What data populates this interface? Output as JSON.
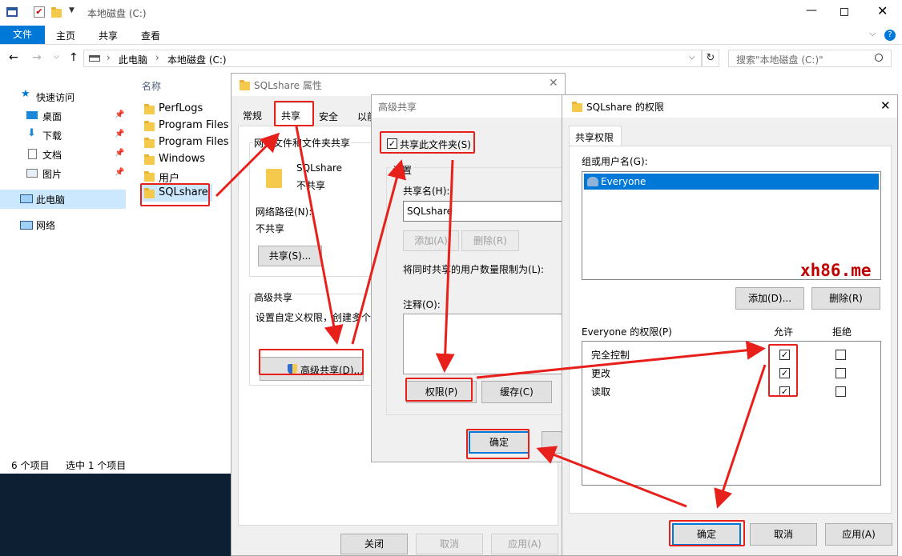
{
  "explorer": {
    "title": "本地磁盘 (C:)",
    "ribbon_tabs": [
      "文件",
      "主页",
      "共享",
      "查看"
    ],
    "breadcrumb": [
      "此电脑",
      "本地磁盘 (C:)"
    ],
    "search_placeholder": "搜索\"本地磁盘 (C:)\"",
    "column_name": "名称",
    "nav": {
      "quick_access": "快速访问",
      "items": [
        "桌面",
        "下载",
        "文档",
        "图片"
      ],
      "this_pc": "此电脑",
      "network": "网络"
    },
    "files": [
      "PerfLogs",
      "Program Files",
      "Program Files (",
      "Windows",
      "用户",
      "SQLshare"
    ],
    "status": {
      "count": "6 个项目",
      "selected": "选中 1 个项目"
    }
  },
  "props": {
    "title": "SQLshare 属性",
    "tabs": [
      "常规",
      "共享",
      "安全",
      "以前"
    ],
    "net_share_group": "网络文件和文件夹共享",
    "folder_name": "SQLshare",
    "folder_state": "不共享",
    "net_path_label": "网络路径(N):",
    "net_path_value": "不共享",
    "share_btn": "共享(S)...",
    "adv_group": "高级共享",
    "adv_desc": "设置自定义权限，创建多个",
    "adv_btn": "高级共享(D)...",
    "close_btn": "关闭",
    "cancel_btn": "取消",
    "apply_btn": "应用(A)"
  },
  "adv": {
    "title": "高级共享",
    "share_checkbox": "共享此文件夹(S)",
    "settings_label": "设置",
    "share_name_label": "共享名(H):",
    "share_name_value": "SQLshare",
    "add_btn": "添加(A)",
    "remove_btn": "删除(R)",
    "limit_label": "将同时共享的用户数量限制为(L):",
    "comment_label": "注释(O):",
    "perm_btn": "权限(P)",
    "cache_btn": "缓存(C)",
    "ok_btn": "确定"
  },
  "perm": {
    "title": "SQLshare 的权限",
    "tab": "共享权限",
    "group_label": "组或用户名(G):",
    "users": [
      "Everyone"
    ],
    "add_btn": "添加(D)...",
    "remove_btn": "删除(R)",
    "perm_for": "Everyone 的权限(P)",
    "allow_col": "允许",
    "deny_col": "拒绝",
    "rows": [
      {
        "name": "完全控制",
        "allow": true,
        "deny": false
      },
      {
        "name": "更改",
        "allow": true,
        "deny": false
      },
      {
        "name": "读取",
        "allow": true,
        "deny": false
      }
    ],
    "ok_btn": "确定",
    "cancel_btn": "取消",
    "apply_btn": "应用(A)"
  },
  "watermark": "xh86.me",
  "colors": {
    "accent": "#0078d7",
    "annotation": "#e8201c",
    "selected": "#cce8ff",
    "list_selected": "#0078d7"
  }
}
